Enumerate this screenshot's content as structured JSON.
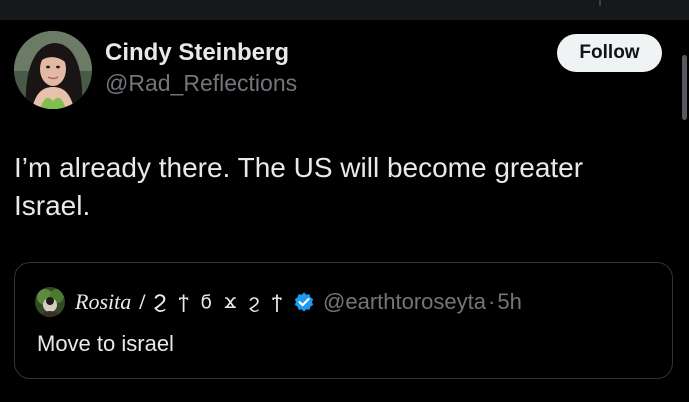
{
  "tweet": {
    "author": {
      "display_name": "Cindy Steinberg",
      "handle": "@Rad_Reflections",
      "avatar_icon": "profile-photo"
    },
    "follow_label": "Follow",
    "text": "I’m already there. The US will become greater Israel.",
    "quoted": {
      "display_name": "Rosita",
      "separator": "/",
      "name_glyphs": "Ϩ ϯ ϭ ϫ ϩ ϯ",
      "verified": true,
      "verified_icon": "verified-badge-icon",
      "handle": "@earthtoroseyta",
      "dot": "·",
      "time": "5h",
      "text": "Move to israel"
    }
  },
  "colors": {
    "background": "#000000",
    "primary_text": "#e7e9ea",
    "secondary_text": "#71767b",
    "verified_blue": "#1d9bf0",
    "follow_button_bg": "#eff3f4",
    "card_border": "#2f3336"
  }
}
